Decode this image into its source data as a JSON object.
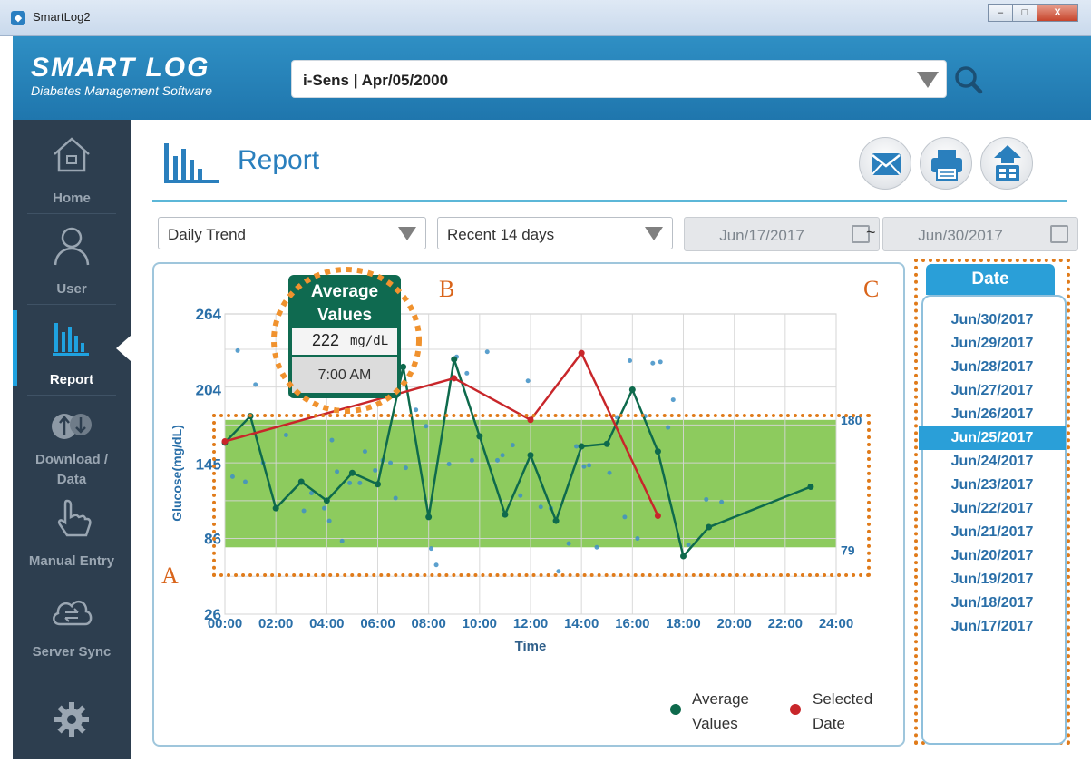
{
  "window": {
    "title": "SmartLog2",
    "min": "–",
    "max": "□",
    "close": "X"
  },
  "header": {
    "logo": "SMART LOG",
    "tagline": "Diabetes Management Software",
    "patient": "i-Sens | Apr/05/2000"
  },
  "sidebar": {
    "items": [
      {
        "label": "Home"
      },
      {
        "label": "User"
      },
      {
        "label": "Report"
      },
      {
        "label": "Download /\nData"
      },
      {
        "label": "Manual Entry"
      },
      {
        "label": "Server Sync"
      }
    ]
  },
  "page": {
    "title": "Report"
  },
  "filters": {
    "report_type": "Daily Trend",
    "range": "Recent 14 days",
    "date_from": "Jun/17/2017",
    "date_to": "Jun/30/2017",
    "separator": "~"
  },
  "tooltip": {
    "title_line1": "Average",
    "title_line2": "Values",
    "value": "222",
    "unit": "mg/dL",
    "time": "7:00 AM"
  },
  "annotations": {
    "a": "A",
    "b": "B",
    "c": "C"
  },
  "legend": {
    "avg_line1": "Average",
    "avg_line2": "Values",
    "sel_line1": "Selected",
    "sel_line2": "Date"
  },
  "date_panel": {
    "header": "Date",
    "dates": [
      "Jun/30/2017",
      "Jun/29/2017",
      "Jun/28/2017",
      "Jun/27/2017",
      "Jun/26/2017",
      "Jun/25/2017",
      "Jun/24/2017",
      "Jun/23/2017",
      "Jun/22/2017",
      "Jun/21/2017",
      "Jun/20/2017",
      "Jun/19/2017",
      "Jun/18/2017",
      "Jun/17/2017"
    ],
    "selected_index": 5
  },
  "colors": {
    "accent": "#2a9fd8",
    "sidebar": "#2d3e4f",
    "target_band": "#8dcb5e",
    "avg_line": "#0e6a4c",
    "selected_line": "#c8262a",
    "scatter": "#3e8fc6",
    "annotation": "#d9641a"
  },
  "chart_data": {
    "type": "line",
    "title": "",
    "xlabel": "Time",
    "ylabel": "Glucose(mg/dL)",
    "xlim": [
      0,
      24
    ],
    "ylim": [
      26,
      264
    ],
    "xticks": [
      "00:00",
      "02:00",
      "04:00",
      "06:00",
      "08:00",
      "10:00",
      "12:00",
      "14:00",
      "16:00",
      "18:00",
      "20:00",
      "22:00",
      "24:00"
    ],
    "yticks": [
      26,
      86,
      145,
      204,
      264
    ],
    "target_range": {
      "low": 79,
      "high": 180,
      "low_label": "79",
      "high_label": "180"
    },
    "series": [
      {
        "name": "Average Values",
        "x": [
          0,
          1,
          2,
          3,
          4,
          5,
          6,
          7,
          8,
          9,
          10,
          11,
          12,
          13,
          14,
          15,
          16,
          17,
          18,
          19,
          23
        ],
        "y": [
          162,
          183,
          110,
          131,
          116,
          138,
          129,
          222,
          103,
          228,
          167,
          105,
          152,
          100,
          159,
          161,
          204,
          155,
          72,
          95,
          127
        ]
      },
      {
        "name": "Selected Date",
        "x": [
          0,
          9,
          12,
          14,
          17
        ],
        "y": [
          163,
          213,
          180,
          233,
          104
        ]
      }
    ],
    "scatter": {
      "x": [
        0.3,
        0.5,
        0.8,
        1.2,
        1.5,
        2.4,
        3.1,
        3.4,
        3.9,
        4.1,
        4.2,
        4.4,
        4.6,
        4.9,
        5.3,
        5.5,
        5.9,
        6.2,
        6.5,
        6.7,
        7.1,
        7.5,
        7.9,
        8.1,
        8.3,
        8.8,
        9.1,
        9.5,
        9.7,
        10.3,
        10.7,
        10.9,
        11.3,
        11.6,
        11.9,
        12.4,
        12.8,
        13.1,
        13.5,
        13.8,
        14.1,
        14.3,
        14.6,
        15.1,
        15.4,
        15.7,
        15.9,
        16.2,
        16.5,
        16.8,
        17.1,
        17.4,
        17.6,
        18.2,
        18.9,
        19.5
      ],
      "y": [
        135,
        235,
        131,
        208,
        146,
        168,
        108,
        122,
        110,
        100,
        164,
        139,
        84,
        130,
        130,
        155,
        140,
        148,
        146,
        118,
        142,
        188,
        175,
        78,
        65,
        145,
        230,
        217,
        148,
        234,
        148,
        152,
        160,
        120,
        211,
        111,
        110,
        60,
        82,
        159,
        143,
        144,
        79,
        138,
        182,
        103,
        227,
        86,
        183,
        225,
        226,
        174,
        196,
        81,
        117,
        115
      ]
    }
  }
}
